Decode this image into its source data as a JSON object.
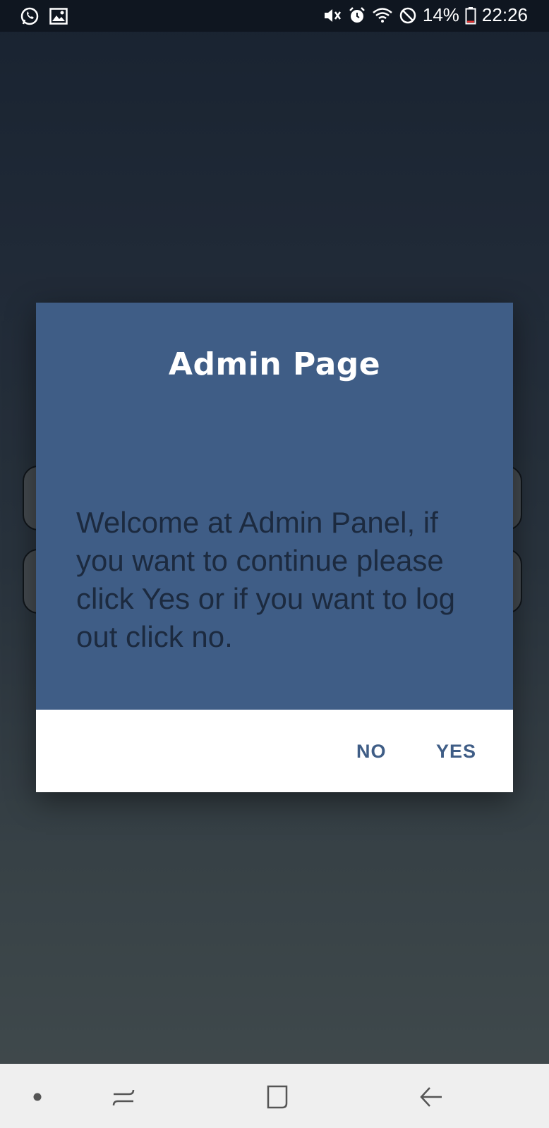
{
  "status_bar": {
    "battery_percent": "14%",
    "time": "22:26",
    "left_icons": [
      "whatsapp-icon",
      "gallery-icon"
    ],
    "right_icons": [
      "mute-icon",
      "alarm-icon",
      "wifi-icon",
      "dnd-icon",
      "battery-icon"
    ],
    "battery_level": 0.14
  },
  "dialog": {
    "title": "Admin Page",
    "message": "Welcome at Admin Panel, if you want to continue please click Yes or if you want to log out click no.",
    "no_label": "NO",
    "yes_label": "YES"
  },
  "colors": {
    "dialog_header": "#3f5d86",
    "dialog_text": "#1c2a3f",
    "button_text": "#3f5d86",
    "status_bar": "#0f1620",
    "nav_bar": "#efefef"
  },
  "nav_bar": {
    "icons": [
      "dot-icon",
      "recents-icon",
      "home-icon",
      "back-icon"
    ]
  }
}
